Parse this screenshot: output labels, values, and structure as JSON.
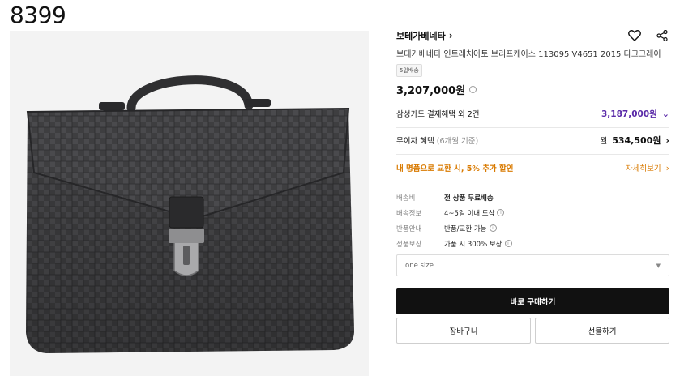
{
  "page_label": "8399",
  "product": {
    "brand": "보테가베네타",
    "title": "보테가베네타 인트레치아토 브리프케이스 113095 V4651 2015 다크그레이",
    "badge": "5일배송",
    "price": "3,207,000원"
  },
  "benefits": {
    "card_label": "삼성카드 결제혜택 외 2건",
    "card_value": "3,187,000원",
    "installment_label": "무이자 혜택",
    "installment_sub": "(6개월 기준)",
    "installment_prefix": "월",
    "installment_value": "534,500원",
    "promo_text": "내 명품으로 교환 시, 5% 추가 할인",
    "promo_link": "자세히보기"
  },
  "details": [
    {
      "label": "배송비",
      "value": "전 상품 무료배송",
      "bold": true,
      "info": false
    },
    {
      "label": "배송정보",
      "value": "4~5일 이내 도착",
      "bold": false,
      "info": true
    },
    {
      "label": "반품안내",
      "value": "반품/교환 가능",
      "bold": false,
      "info": true
    },
    {
      "label": "정품보장",
      "value": "가품 시 300% 보장",
      "bold": false,
      "info": true
    }
  ],
  "option_select": {
    "value": "one size"
  },
  "actions": {
    "buy": "바로 구매하기",
    "cart": "장바구니",
    "gift": "선물하기"
  },
  "colors": {
    "card_accent": "#5a2aa8",
    "promo_accent": "#d97a00",
    "primary_button": "#111111"
  },
  "icons": [
    "heart-icon",
    "share-icon",
    "chevron-right-icon",
    "chevron-down-icon",
    "info-icon"
  ]
}
